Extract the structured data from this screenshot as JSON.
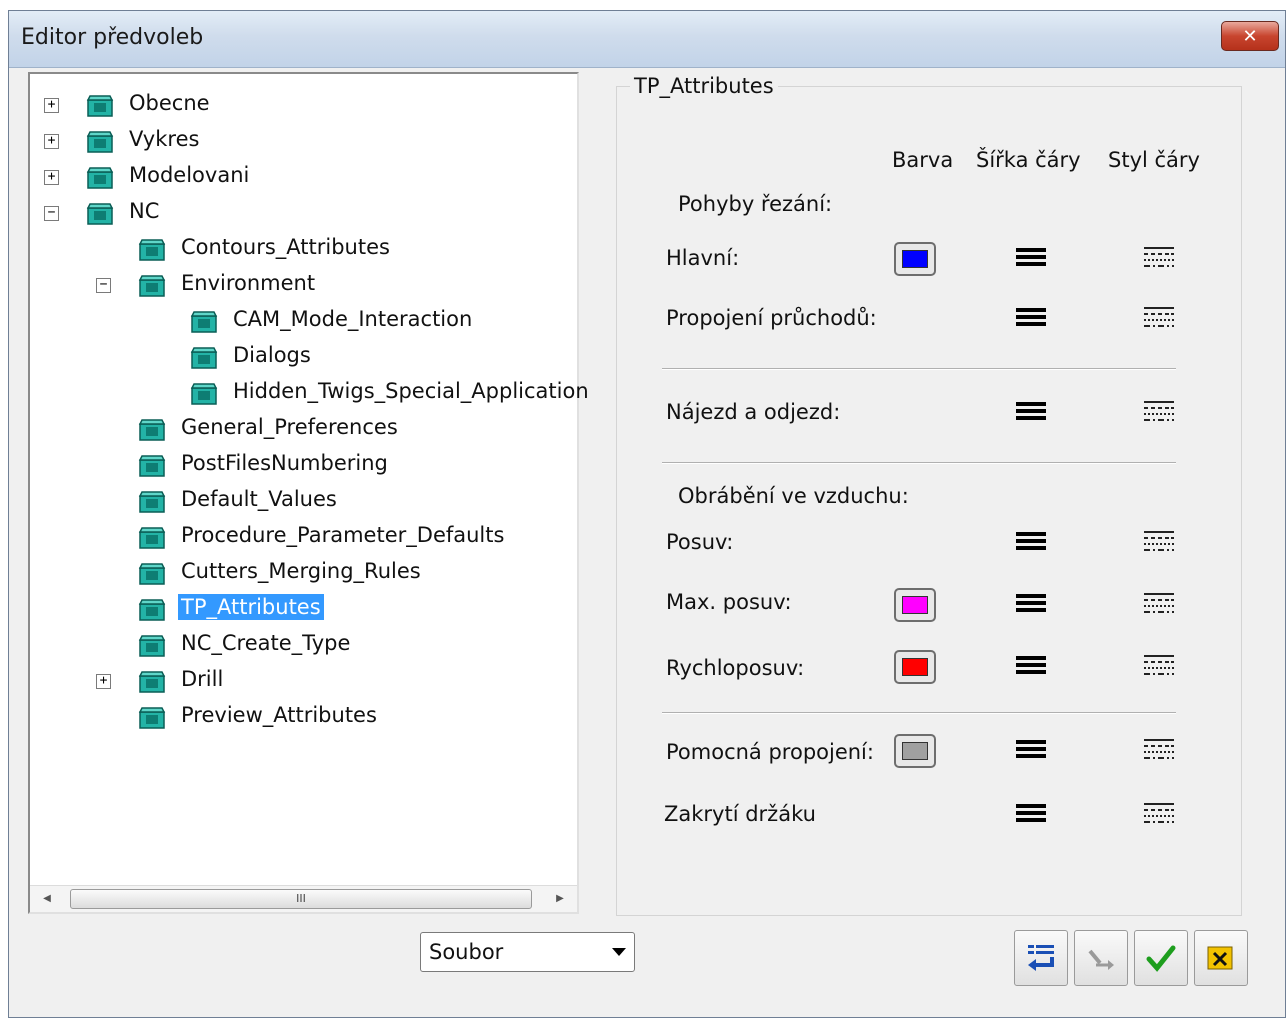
{
  "window": {
    "title": "Editor předvoleb",
    "close_label": "✕"
  },
  "tree": {
    "nodes": [
      {
        "label": "Obecne",
        "expander": "+"
      },
      {
        "label": "Vykres",
        "expander": "+"
      },
      {
        "label": "Modelovani",
        "expander": "+"
      },
      {
        "label": "NC",
        "expander": "−"
      },
      {
        "label": "Contours_Attributes",
        "expander": ""
      },
      {
        "label": "Environment",
        "expander": "−"
      },
      {
        "label": "CAM_Mode_Interaction",
        "expander": ""
      },
      {
        "label": "Dialogs",
        "expander": ""
      },
      {
        "label": "Hidden_Twigs_Special_Application",
        "expander": ""
      },
      {
        "label": "General_Preferences",
        "expander": ""
      },
      {
        "label": "PostFilesNumbering",
        "expander": ""
      },
      {
        "label": "Default_Values",
        "expander": ""
      },
      {
        "label": "Procedure_Parameter_Defaults",
        "expander": ""
      },
      {
        "label": "Cutters_Merging_Rules",
        "expander": ""
      },
      {
        "label": "TP_Attributes",
        "expander": "",
        "selected": true
      },
      {
        "label": "NC_Create_Type",
        "expander": ""
      },
      {
        "label": "Drill",
        "expander": "+"
      },
      {
        "label": "Preview_Attributes",
        "expander": ""
      }
    ],
    "scroll_thumb_glyph": "III",
    "scroll_left": "◀",
    "scroll_right": "▶"
  },
  "panel": {
    "title": "TP_Attributes",
    "columns": {
      "color": "Barva",
      "width": "Šířka čáry",
      "style": "Styl čáry"
    },
    "sections": {
      "cutting": "Pohyby řezání:",
      "air": "Obrábění ve vzduchu:"
    },
    "rows": {
      "main": "Hlavní:",
      "pass_link": "Propojení průchodů:",
      "approach": "Nájezd a odjezd:",
      "feed": "Posuv:",
      "max_feed": "Max. posuv:",
      "rapid": "Rychloposuv:",
      "aux_link": "Pomocná propojení:",
      "holder": "Zakrytí držáku"
    },
    "colors": {
      "main": "#0000ff",
      "max_feed": "#ff00ff",
      "rapid": "#ff0000",
      "aux_link": "#a0a0a0"
    }
  },
  "bottom": {
    "combo_value": "Soubor",
    "buttons": [
      "apply-list-icon",
      "undo-icon",
      "ok-check-icon",
      "cancel-icon"
    ]
  }
}
